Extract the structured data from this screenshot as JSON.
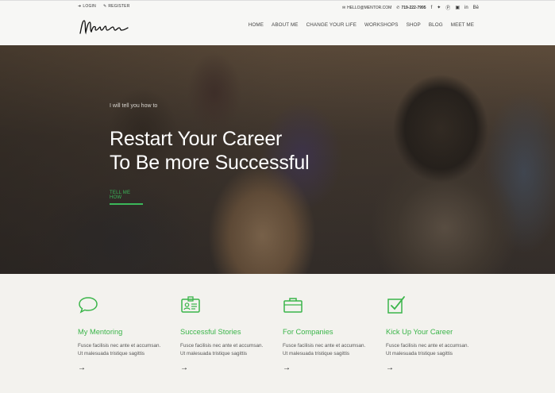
{
  "topbar": {
    "login": "LOGIN",
    "register": "REGISTER",
    "email": "HELLO@MENTOR.COM",
    "phone": "719-222-7995",
    "social_icons": [
      "facebook-icon",
      "twitter-icon",
      "pinterest-icon",
      "instagram-icon",
      "linkedin-icon",
      "behance-icon"
    ]
  },
  "header": {
    "logo_alt": "Mentor",
    "nav": [
      "HOME",
      "ABOUT ME",
      "CHANGE YOUR LIFE",
      "WORKSHOPS",
      "SHOP",
      "BLOG",
      "MEET ME"
    ]
  },
  "hero": {
    "pretitle": "I will tell you how to",
    "title_line1": "Restart Your Career",
    "title_line2": "To Be more Successful",
    "cta": "TELL ME HOW"
  },
  "features": [
    {
      "icon": "speech-bubble-icon",
      "title": "My Mentoring",
      "desc1": "Fusce facilisis nec ante et accumsan.",
      "desc2": "Ut malesuada tristique sagittis"
    },
    {
      "icon": "id-card-icon",
      "title": "Successful Stories",
      "desc1": "Fusce facilisis nec ante et accumsan.",
      "desc2": "Ut malesuada tristique sagittis"
    },
    {
      "icon": "briefcase-icon",
      "title": "For Companies",
      "desc1": "Fusce facilisis nec ante et accumsan.",
      "desc2": "Ut malesuada tristique sagittis"
    },
    {
      "icon": "checkbox-icon",
      "title": "Kick Up Your Career",
      "desc1": "Fusce facilisis nec ante et accumsan.",
      "desc2": "Ut malesuada tristique sagittis"
    }
  ],
  "colors": {
    "accent": "#3bb54a",
    "header_bg": "#f7f7f5",
    "section_bg": "#f3f2ee"
  }
}
